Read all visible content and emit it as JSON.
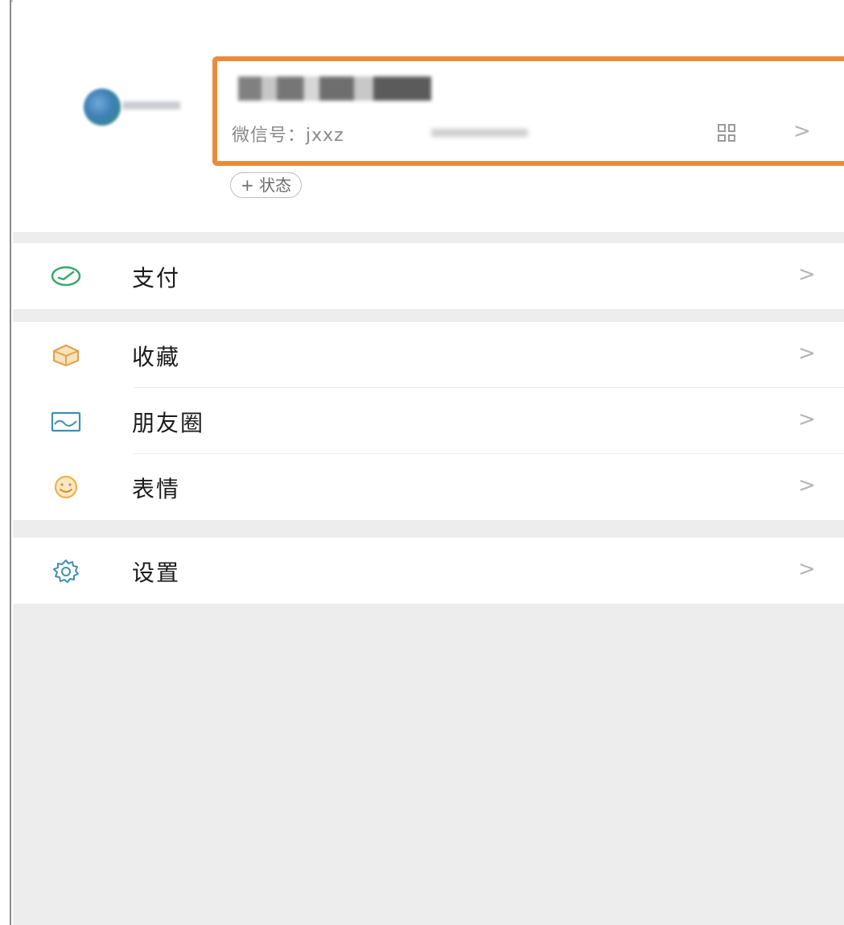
{
  "profile": {
    "wechat_id_label": "微信号：",
    "wechat_id_value": "jxxz",
    "status_button": "+ 状态",
    "chevron": ">",
    "highlight_color": "#ec8a3b"
  },
  "menu": {
    "pay": {
      "label": "支付",
      "icon": "pay-icon",
      "arrow": ">"
    },
    "favorites": {
      "label": "收藏",
      "icon": "favorites-icon",
      "arrow": ">"
    },
    "moments": {
      "label": "朋友圈",
      "icon": "moments-icon",
      "arrow": ">"
    },
    "stickers": {
      "label": "表情",
      "icon": "stickers-icon",
      "arrow": ">"
    },
    "settings": {
      "label": "设置",
      "icon": "settings-icon",
      "arrow": ">"
    }
  },
  "colors": {
    "pay": "#3aa86b",
    "favorites": "#e3a34a",
    "moments": "#3f8fb2",
    "stickers": "#f0b24a",
    "settings": "#3f8fb2"
  }
}
